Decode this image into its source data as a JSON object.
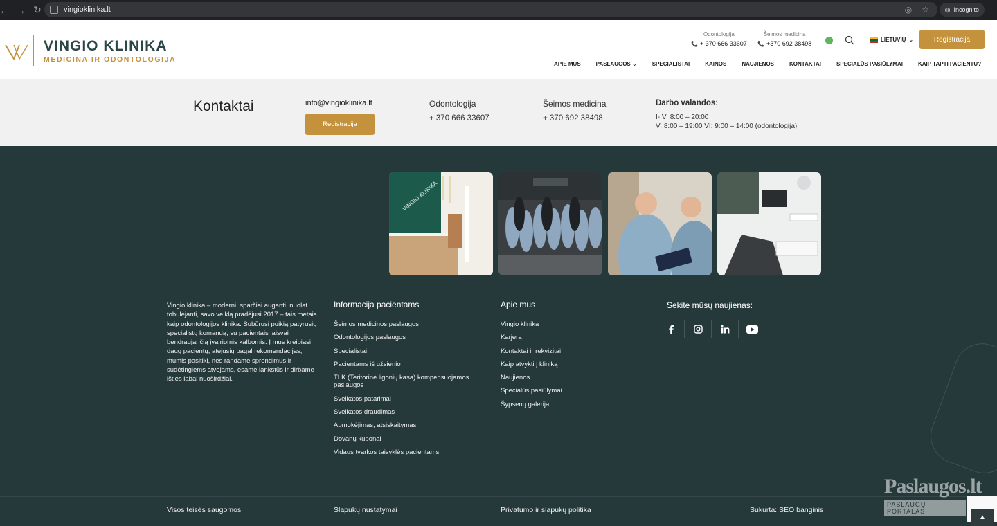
{
  "browser": {
    "url": "vingioklinika.lt",
    "incognito_label": "Incognito"
  },
  "header": {
    "logo_title": "VINGIO KLINIKA",
    "logo_subtitle": "MEDICINA IR ODONTOLOGIJA",
    "phones": [
      {
        "label": "Odontologija",
        "number": "+ 370 666 33607"
      },
      {
        "label": "Šeimos medicina",
        "number": "+370 692 38498"
      }
    ],
    "language": "LIETUVIŲ",
    "register_label": "Registracija",
    "nav": [
      "APIE MUS",
      "PASLAUGOS",
      "SPECIALISTAI",
      "KAINOS",
      "NAUJIENOS",
      "KONTAKTAI",
      "SPECIALŪS PASIŪLYMAI",
      "KAIP TAPTI PACIENTU?"
    ]
  },
  "contacts": {
    "title": "Kontaktai",
    "email": "info@vingioklinika.lt",
    "register_label": "Registracija",
    "dental_label": "Odontologija",
    "dental_phone": "+ 370 666 33607",
    "family_label": "Šeimos medicina",
    "family_phone": "+ 370 692 38498",
    "hours_title": "Darbo valandos:",
    "hours_line1": "I-IV: 8:00 – 20:00",
    "hours_line2": "V: 8:00 – 19:00 VI: 9:00 – 14:00 (odontologija)"
  },
  "footer": {
    "about_text": "Vingio klinika – moderni, sparčiai auganti, nuolat tobulėjanti, savo veiklą pradėjusi 2017 – tais metais kaip odontologijos klinika. Subūrusi puikią patyrusių specialistų komandą, su pacientais laisvai bendraujančią įvairiomis kalbomis. Į mus kreipiasi daug pacientų, atėjusių pagal rekomendacijas, mumis pasitiki, nes randame sprendimus ir sudėtingiems atvejams, esame lankstūs ir dirbame išties labai nuoširdžiai.",
    "patients_heading": "Informacija pacientams",
    "patients_links": [
      "Šeimos medicinos paslaugos",
      "Odontologijos paslaugos",
      "Specialistai",
      "Pacientams iš užsienio",
      "TLK (Teritorinė ligonių kasa) kompensuojamos paslaugos",
      "Sveikatos patarimai",
      "Sveikatos draudimas",
      "Apmokėjimas, atsiskaitymas",
      "Dovanų kuponai",
      "Vidaus tvarkos taisyklės pacientams"
    ],
    "about_heading": "Apie mus",
    "about_links": [
      "Vingio klinika",
      "Karjera",
      "Kontaktai ir rekvizitai",
      "Kaip atvykti į kliniką",
      "Naujienos",
      "Specialūs pasiūlymai",
      "Šypsenų galerija"
    ],
    "follow_heading": "Sekite mūsų naujienas:",
    "socials": [
      "facebook-icon",
      "instagram-icon",
      "linkedin-icon",
      "youtube-icon"
    ],
    "bottom": {
      "rights": "Visos teisės saugomos",
      "cookies": "Slapukų nustatymai",
      "privacy": "Privatumo ir slapukų politika",
      "made_by": "Sukurta: SEO banginis"
    },
    "badge_title": "Paslaugos.lt",
    "badge_sub": "PASLAUGŲ PORTALAS"
  },
  "colors": {
    "accent": "#c4923c",
    "footer_bg": "#25393b",
    "band_bg": "#f1f1f1"
  }
}
